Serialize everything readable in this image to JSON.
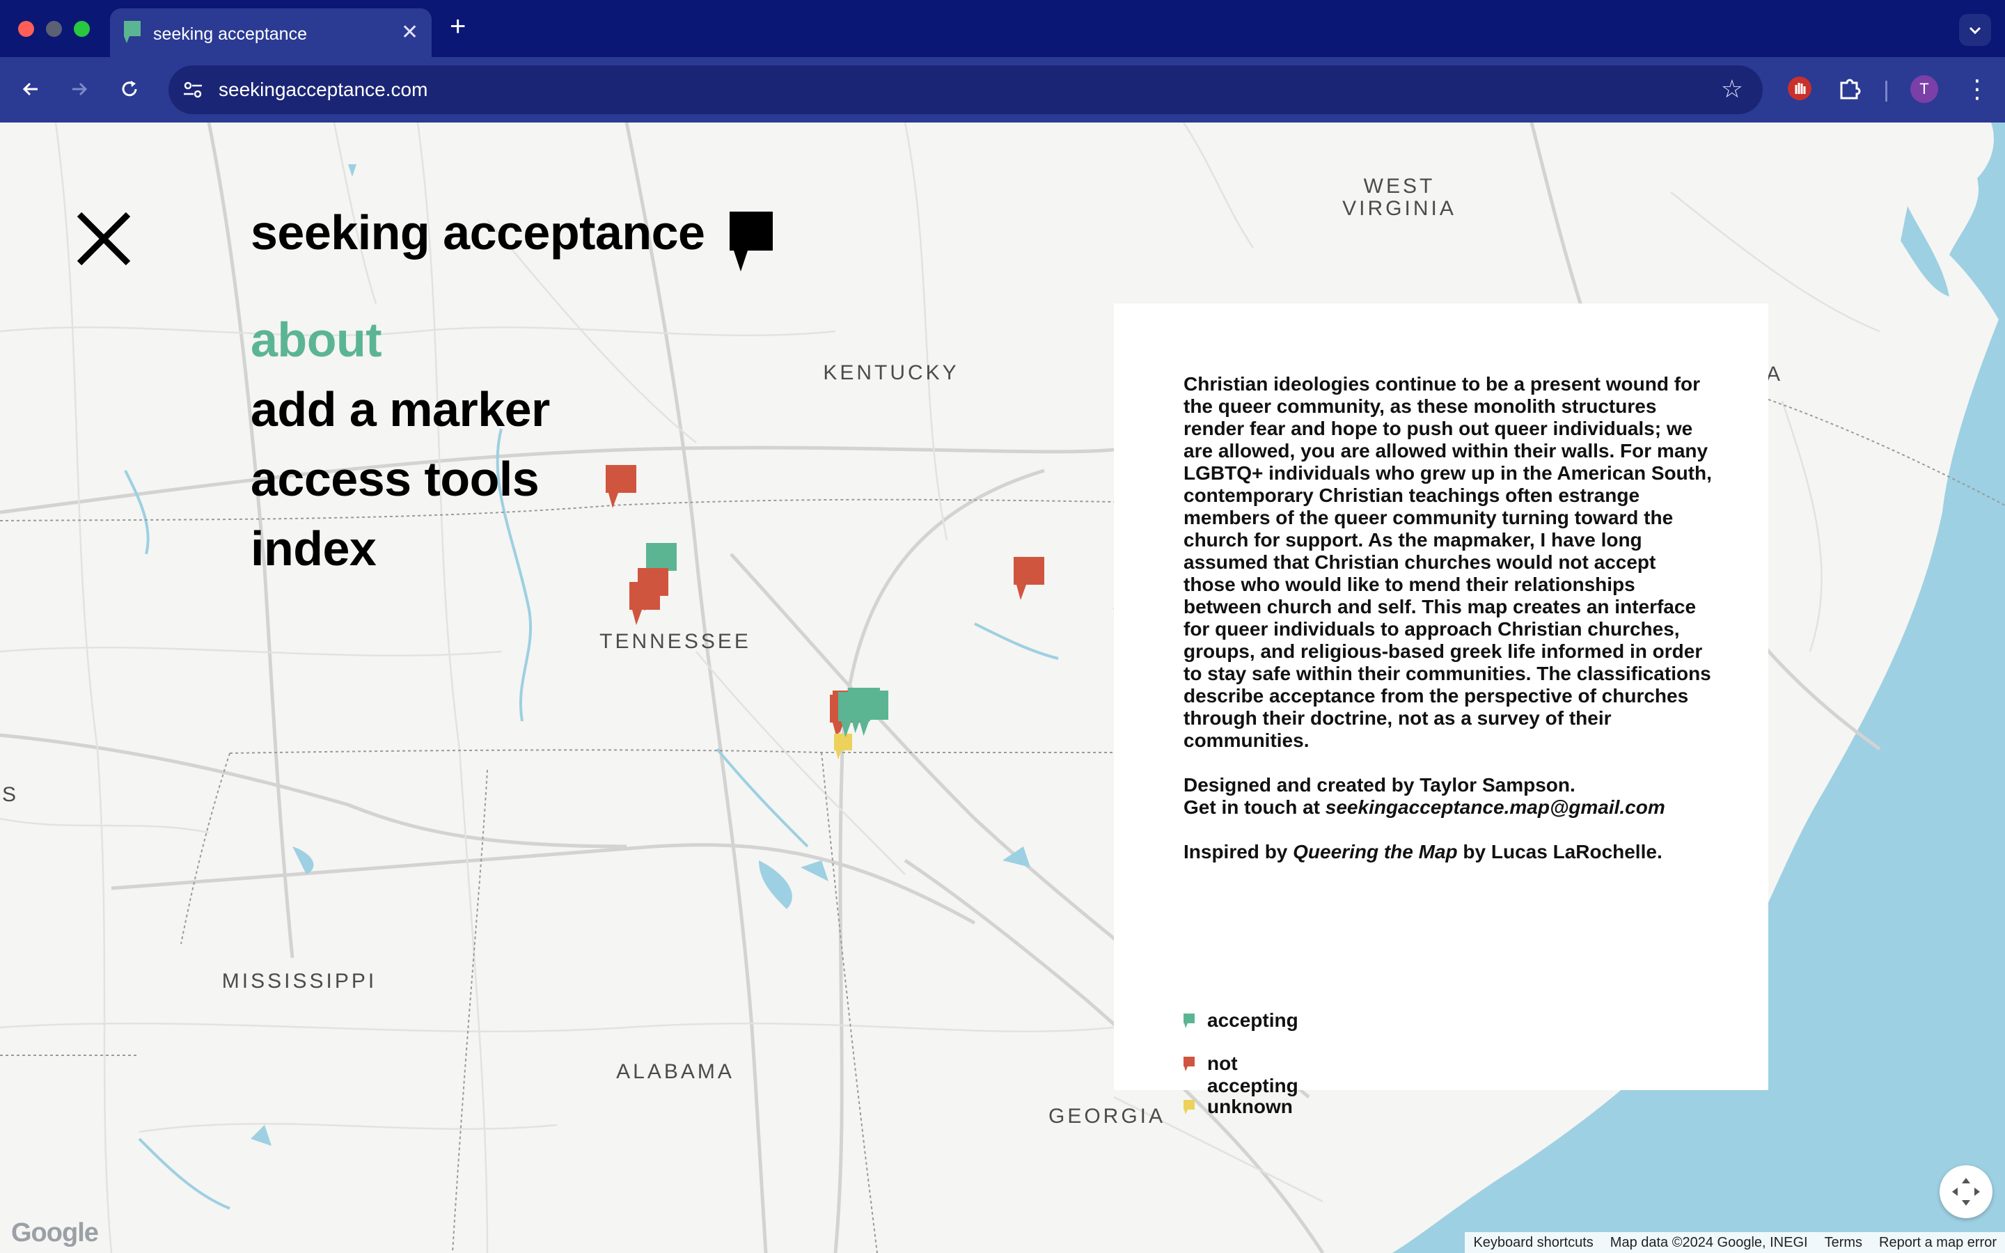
{
  "browser": {
    "tab_title": "seeking acceptance",
    "new_tab": "+",
    "close_tab": "✕",
    "url": "seekingacceptance.com",
    "profile_initial": "T"
  },
  "map": {
    "state_labels": {
      "west_virginia": "WEST\nVIRGINIA",
      "kentucky": "KENTUCKY",
      "tennessee": "TENNESSEE",
      "mississippi": "MISSISSIPPI",
      "alabama": "ALABAMA",
      "georgia": "GEORGIA",
      "edge_a": "A",
      "edge_s": "S"
    },
    "google_logo": "Google",
    "attribution": [
      "Keyboard shortcuts",
      "Map data ©2024 Google, INEGI",
      "Terms",
      "Report a map error"
    ]
  },
  "site": {
    "title": "seeking acceptance",
    "menu": [
      "about",
      "add a marker",
      "access tools",
      "index"
    ],
    "active_menu": "about"
  },
  "about": {
    "body": "Christian ideologies continue to be a present wound for the queer community, as these monolith structures render fear and hope to push out queer individuals; we are allowed, you are allowed within their walls. For many LGBTQ+ individuals who grew up in the American South, contemporary Christian teachings often estrange members of the queer community turning toward the church for support. As the mapmaker, I have long assumed that Christian churches would not accept those who would like to mend their relationships between church and self. This map creates an interface for queer individuals to approach Christian churches, groups, and religious-based greek life informed in order to stay safe within their communities. The classifications describe acceptance from the perspective of churches through their doctrine, not as a survey of their communities.",
    "designed": "Designed and created by Taylor Sampson.",
    "contact_prefix": "Get in touch at ",
    "contact_email": "seekingacceptance.map@gmail.com",
    "inspired_prefix": "Inspired by ",
    "inspired_work": "Queering the Map",
    "inspired_suffix": " by Lucas LaRochelle."
  },
  "legend": [
    {
      "label": "accepting",
      "color": "#5bb593"
    },
    {
      "label": "not accepting",
      "color": "#d0553e"
    },
    {
      "label": "unknown",
      "color": "#ecd25a"
    }
  ],
  "colors": {
    "accepting": "#5bb593",
    "not_accepting": "#d0553e",
    "unknown": "#ecd25a",
    "water": "#9dd0e2",
    "chrome_dark": "#0a1775",
    "chrome_light": "#2b3a92"
  },
  "markers": [
    {
      "status": "not_accepting"
    },
    {
      "status": "accepting"
    },
    {
      "status": "not_accepting"
    },
    {
      "status": "not_accepting"
    },
    {
      "status": "not_accepting"
    },
    {
      "status": "not_accepting"
    },
    {
      "status": "not_accepting"
    },
    {
      "status": "unknown"
    },
    {
      "status": "accepting"
    },
    {
      "status": "accepting"
    },
    {
      "status": "accepting"
    }
  ]
}
